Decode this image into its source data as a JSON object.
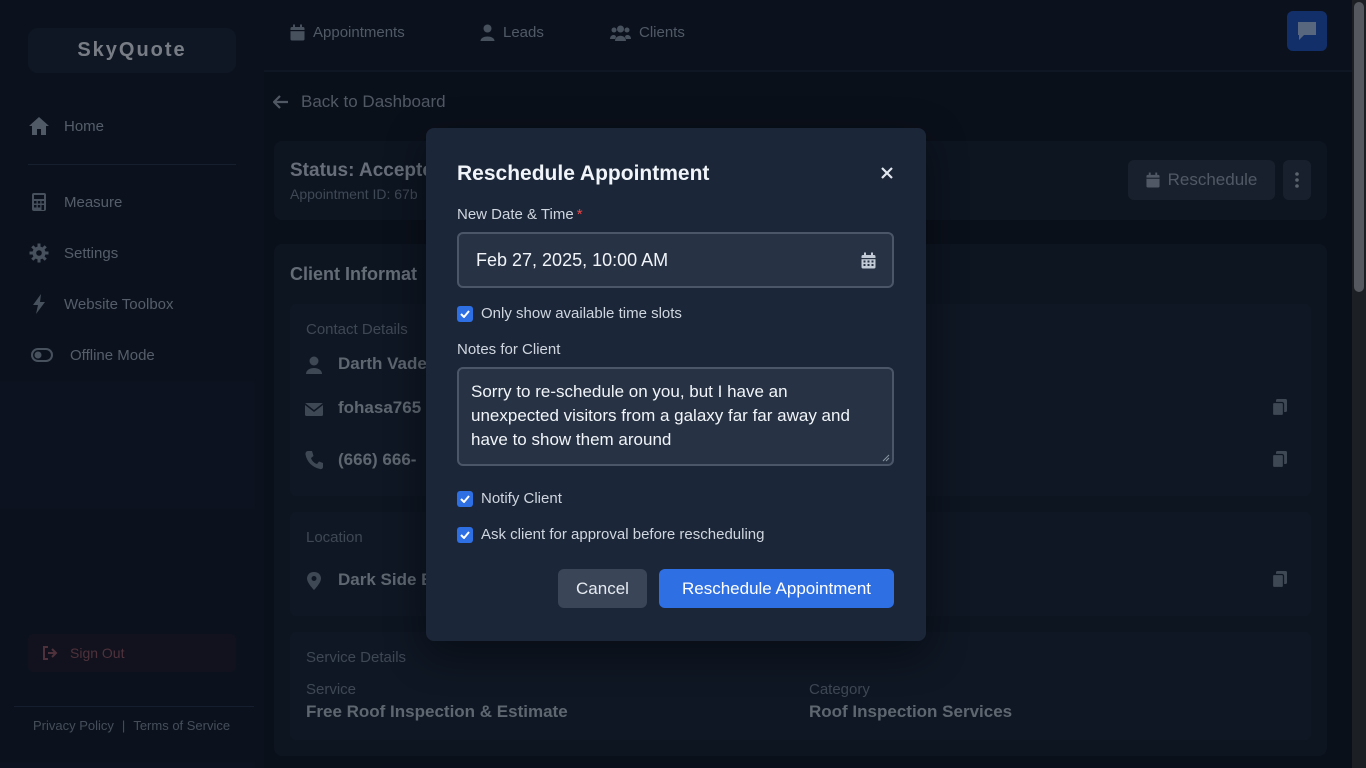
{
  "app": {
    "logo": "SkyQuote"
  },
  "sidebar": {
    "items": [
      {
        "label": "Home",
        "icon": "home-icon"
      },
      {
        "label": "Measure",
        "icon": "calculator-icon"
      },
      {
        "label": "Settings",
        "icon": "gear-icon"
      },
      {
        "label": "Website Toolbox",
        "icon": "bolt-icon"
      },
      {
        "label": "Offline Mode",
        "icon": "toggle-icon"
      }
    ],
    "signout": "Sign Out",
    "footer": {
      "privacy": "Privacy Policy",
      "separator": "|",
      "terms": "Terms of Service"
    }
  },
  "topnav": {
    "tabs": [
      {
        "label": "Appointments",
        "icon": "calendar-icon"
      },
      {
        "label": "Leads",
        "icon": "user-icon"
      },
      {
        "label": "Clients",
        "icon": "users-icon"
      }
    ]
  },
  "main": {
    "back": "Back to Dashboard",
    "status_title": "Status: Accepte",
    "appointment_id": "Appointment ID: 67b",
    "reschedule_button": "Reschedule",
    "client_info_title": "Client Informat",
    "contact_details_label": "Contact Details",
    "contact_name": "Darth Vade",
    "contact_email": "fohasa765",
    "contact_phone": "(666) 666-",
    "location_label": "Location",
    "location_value": "Dark Side B",
    "service_details_label": "Service Details",
    "service_label": "Service",
    "service_value": "Free Roof Inspection & Estimate",
    "category_label": "Category",
    "category_value": "Roof Inspection Services"
  },
  "modal": {
    "title": "Reschedule Appointment",
    "date_label": "New Date & Time",
    "required_mark": "*",
    "date_value": "Feb 27, 2025, 10:00 AM",
    "only_available_label": "Only show available time slots",
    "only_available_checked": true,
    "notes_label": "Notes for Client",
    "notes_value": "Sorry to re-schedule on you, but I have an unexpected visitors from a galaxy far far away and have to show them around",
    "notify_label": "Notify Client",
    "notify_checked": true,
    "approval_label": "Ask client for approval before rescheduling",
    "approval_checked": true,
    "cancel": "Cancel",
    "submit": "Reschedule Appointment"
  },
  "colors": {
    "primary": "#2f6fe4",
    "background": "#0f1624",
    "modal_bg": "#1b2638",
    "danger": "#ef4444"
  }
}
